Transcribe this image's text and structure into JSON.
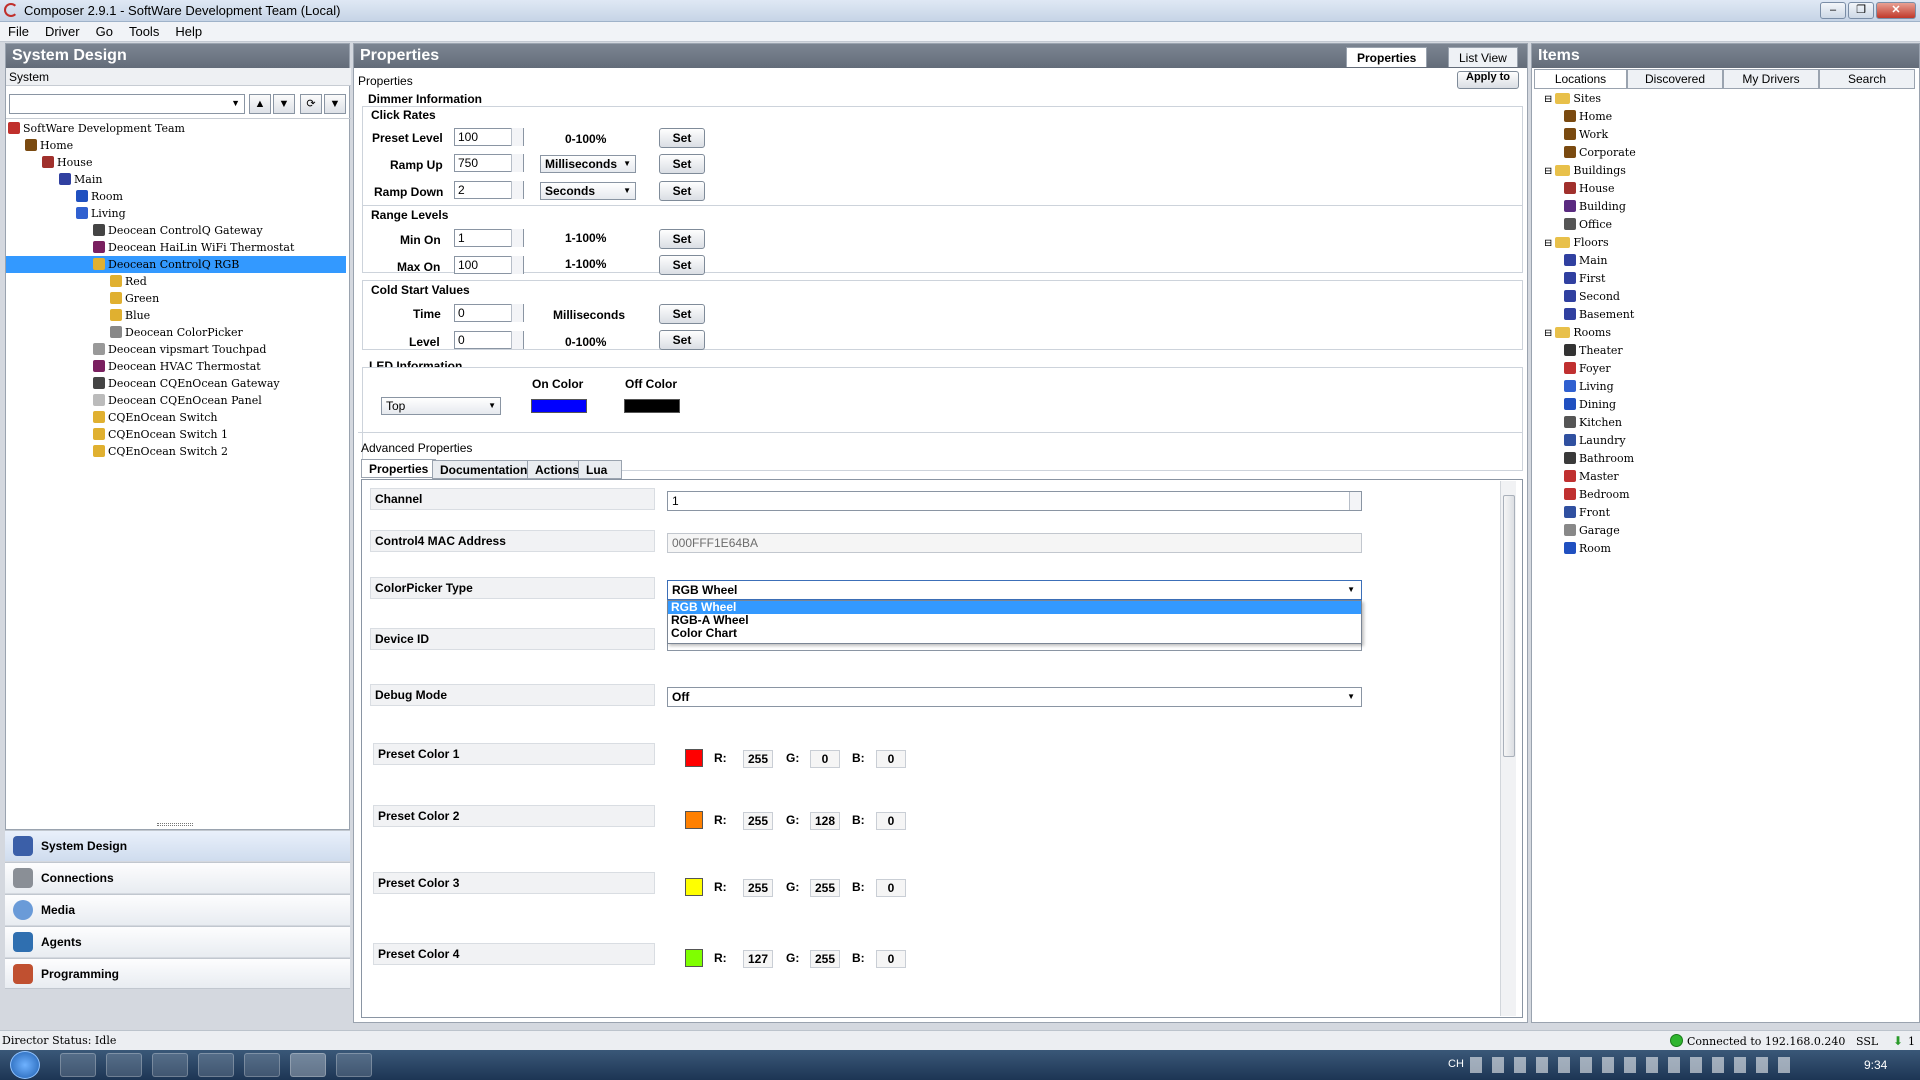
{
  "window": {
    "title": "Composer 2.9.1 - SoftWare Development Team (Local)"
  },
  "menu": [
    "File",
    "Driver",
    "Go",
    "Tools",
    "Help"
  ],
  "system_design": {
    "title": "System Design",
    "subtitle": "System",
    "tree": [
      {
        "label": "SoftWare Development Team",
        "depth": 0,
        "color": "#c0302c"
      },
      {
        "label": "Home",
        "depth": 1,
        "color": "#7a4a10"
      },
      {
        "label": "House",
        "depth": 2,
        "color": "#a0302c"
      },
      {
        "label": "Main",
        "depth": 3,
        "color": "#3040a0"
      },
      {
        "label": "Room",
        "depth": 4,
        "color": "#2050c0"
      },
      {
        "label": "Living",
        "depth": 4,
        "color": "#3060d0"
      },
      {
        "label": "Deocean ControlQ Gateway",
        "depth": 5,
        "color": "#444"
      },
      {
        "label": "Deocean HaiLin WiFi Thermostat",
        "depth": 5,
        "color": "#7a2060"
      },
      {
        "label": "Deocean ControlQ RGB",
        "depth": 5,
        "color": "#e0b030",
        "selected": true
      },
      {
        "label": "Red",
        "depth": 6,
        "color": "#e0b030"
      },
      {
        "label": "Green",
        "depth": 6,
        "color": "#e0b030"
      },
      {
        "label": "Blue",
        "depth": 6,
        "color": "#e0b030"
      },
      {
        "label": "Deocean ColorPicker",
        "depth": 6,
        "color": "#888"
      },
      {
        "label": "Deocean vipsmart Touchpad",
        "depth": 5,
        "color": "#999"
      },
      {
        "label": "Deocean HVAC Thermostat",
        "depth": 5,
        "color": "#7a2060"
      },
      {
        "label": "Deocean CQEnOcean Gateway",
        "depth": 5,
        "color": "#444"
      },
      {
        "label": "Deocean CQEnOcean Panel",
        "depth": 5,
        "color": "#bbb"
      },
      {
        "label": "CQEnOcean Switch",
        "depth": 5,
        "color": "#e0b030"
      },
      {
        "label": "CQEnOcean Switch 1",
        "depth": 5,
        "color": "#e0b030"
      },
      {
        "label": "CQEnOcean Switch 2",
        "depth": 5,
        "color": "#e0b030"
      }
    ],
    "nav": [
      {
        "label": "System Design",
        "icon": "system-design-icon",
        "active": true
      },
      {
        "label": "Connections",
        "icon": "connections-icon"
      },
      {
        "label": "Media",
        "icon": "media-icon"
      },
      {
        "label": "Agents",
        "icon": "agents-icon"
      },
      {
        "label": "Programming",
        "icon": "programming-icon"
      }
    ]
  },
  "properties": {
    "title": "Properties",
    "tab_properties": "Properties",
    "tab_listview": "List View",
    "sub": "Properties",
    "apply": "Apply to",
    "dimmer": {
      "header": "Dimmer Information",
      "click_rates": "Click Rates",
      "preset_level": {
        "label": "Preset Level",
        "value": "100",
        "range": "0-100%"
      },
      "ramp_up": {
        "label": "Ramp Up",
        "value": "750",
        "unit": "Milliseconds"
      },
      "ramp_down": {
        "label": "Ramp Down",
        "value": "2",
        "unit": "Seconds"
      },
      "range_levels": "Range Levels",
      "min_on": {
        "label": "Min On",
        "value": "1",
        "range": "1-100%"
      },
      "max_on": {
        "label": "Max On",
        "value": "100",
        "range": "1-100%"
      },
      "cold_start": "Cold Start Values",
      "time": {
        "label": "Time",
        "value": "0",
        "unit": "Milliseconds"
      },
      "level": {
        "label": "Level",
        "value": "0",
        "range": "0-100%"
      },
      "set": "Set"
    },
    "led": {
      "header": "LED Information",
      "position": "Top",
      "on_color": "On Color",
      "off_color": "Off Color",
      "on_hex": "#0000ff",
      "off_hex": "#000000"
    },
    "advanced": {
      "title": "Advanced Properties",
      "tabs": [
        "Properties",
        "Documentation",
        "Actions",
        "Lua"
      ],
      "channel": {
        "label": "Channel",
        "value": "1"
      },
      "mac": {
        "label": "Control4 MAC Address",
        "value": "000FFF1E64BA"
      },
      "colorpicker": {
        "label": "ColorPicker Type",
        "value": "RGB Wheel",
        "options": [
          "RGB Wheel",
          "RGB-A Wheel",
          "Color Chart"
        ]
      },
      "device_id": {
        "label": "Device ID"
      },
      "debug": {
        "label": "Debug Mode",
        "value": "Off"
      },
      "presets": [
        {
          "label": "Preset Color 1",
          "hex": "#ff0000",
          "r": "255",
          "g": "0",
          "b": "0"
        },
        {
          "label": "Preset Color 2",
          "hex": "#ff8000",
          "r": "255",
          "g": "128",
          "b": "0"
        },
        {
          "label": "Preset Color 3",
          "hex": "#ffff00",
          "r": "255",
          "g": "255",
          "b": "0"
        },
        {
          "label": "Preset Color 4",
          "hex": "#7fff00",
          "r": "127",
          "g": "255",
          "b": "0"
        }
      ],
      "r": "R:",
      "g": "G:",
      "b": "B:"
    }
  },
  "items": {
    "title": "Items",
    "tabs": [
      "Locations",
      "Discovered",
      "My Drivers",
      "Search"
    ],
    "tree": [
      {
        "label": "Sites",
        "depth": 0,
        "folder": true
      },
      {
        "label": "Home",
        "depth": 1,
        "color": "#7a4a10"
      },
      {
        "label": "Work",
        "depth": 1,
        "color": "#7a4a10"
      },
      {
        "label": "Corporate",
        "depth": 1,
        "color": "#7a4a10"
      },
      {
        "label": "Buildings",
        "depth": 0,
        "folder": true
      },
      {
        "label": "House",
        "depth": 1,
        "color": "#a0302c"
      },
      {
        "label": "Building",
        "depth": 1,
        "color": "#5a2a80"
      },
      {
        "label": "Office",
        "depth": 1,
        "color": "#555"
      },
      {
        "label": "Floors",
        "depth": 0,
        "folder": true
      },
      {
        "label": "Main",
        "depth": 1,
        "color": "#3040a0"
      },
      {
        "label": "First",
        "depth": 1,
        "color": "#3040a0"
      },
      {
        "label": "Second",
        "depth": 1,
        "color": "#3040a0"
      },
      {
        "label": "Basement",
        "depth": 1,
        "color": "#3040a0"
      },
      {
        "label": "Rooms",
        "depth": 0,
        "folder": true
      },
      {
        "label": "Theater",
        "depth": 1,
        "color": "#333"
      },
      {
        "label": "Foyer",
        "depth": 1,
        "color": "#c03030"
      },
      {
        "label": "Living",
        "depth": 1,
        "color": "#3060d0"
      },
      {
        "label": "Dining",
        "depth": 1,
        "color": "#2050c0"
      },
      {
        "label": "Kitchen",
        "depth": 1,
        "color": "#555"
      },
      {
        "label": "Laundry",
        "depth": 1,
        "color": "#3050a0"
      },
      {
        "label": "Bathroom",
        "depth": 1,
        "color": "#3a3a3a"
      },
      {
        "label": "Master",
        "depth": 1,
        "color": "#c03030"
      },
      {
        "label": "Bedroom",
        "depth": 1,
        "color": "#c03030"
      },
      {
        "label": "Front",
        "depth": 1,
        "color": "#3050a0"
      },
      {
        "label": "Garage",
        "depth": 1,
        "color": "#888"
      },
      {
        "label": "Room",
        "depth": 1,
        "color": "#2050c0"
      }
    ]
  },
  "status": {
    "director": "Director Status: Idle",
    "connection": "Connected to 192.168.0.240",
    "ssl": "SSL",
    "count": "1"
  },
  "taskbar": {
    "clock": "9:34",
    "lang": "CH"
  }
}
